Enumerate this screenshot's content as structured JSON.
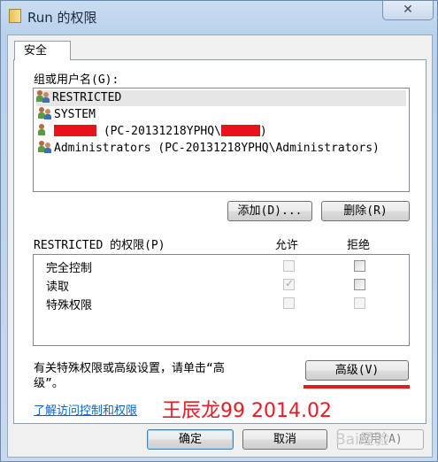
{
  "window": {
    "title": "Run 的权限",
    "close_glyph": "✕"
  },
  "tab": {
    "label": "安全"
  },
  "groups": {
    "label": "组或用户名(G):",
    "items": [
      {
        "name": "RESTRICTED",
        "icon": "group-users-icon",
        "selected": true
      },
      {
        "name": "SYSTEM",
        "icon": "group-users-icon",
        "selected": false
      },
      {
        "name_prefix": "",
        "name_middle": " (PC-20131218YPHQ\\",
        "name_suffix": ")",
        "icon": "user-icon",
        "redacted": true
      },
      {
        "name": "Administrators (PC-20131218YPHQ\\Administrators)",
        "icon": "group-users-icon",
        "selected": false
      }
    ]
  },
  "buttons": {
    "add": "添加(D)...",
    "remove": "删除(R)",
    "advanced": "高级(V)",
    "ok": "确定",
    "cancel": "取消",
    "apply": "应用(A)"
  },
  "permissions": {
    "header_label": "RESTRICTED 的权限(P)",
    "allow_label": "允许",
    "deny_label": "拒绝",
    "rows": [
      {
        "name": "完全控制",
        "allow": false,
        "deny": false
      },
      {
        "name": "读取",
        "allow": true,
        "deny": false
      },
      {
        "name": "特殊权限",
        "allow": false,
        "deny": false
      }
    ]
  },
  "advanced_note": {
    "line1": "有关特殊权限或高级设置，请单击“高",
    "line2": "级”。"
  },
  "link_text": "了解访问控制和权限",
  "annotation": {
    "watermark_text": "王辰龙99 2014.02",
    "color": "#e51c23"
  },
  "baidu_watermark": "Bai经验"
}
